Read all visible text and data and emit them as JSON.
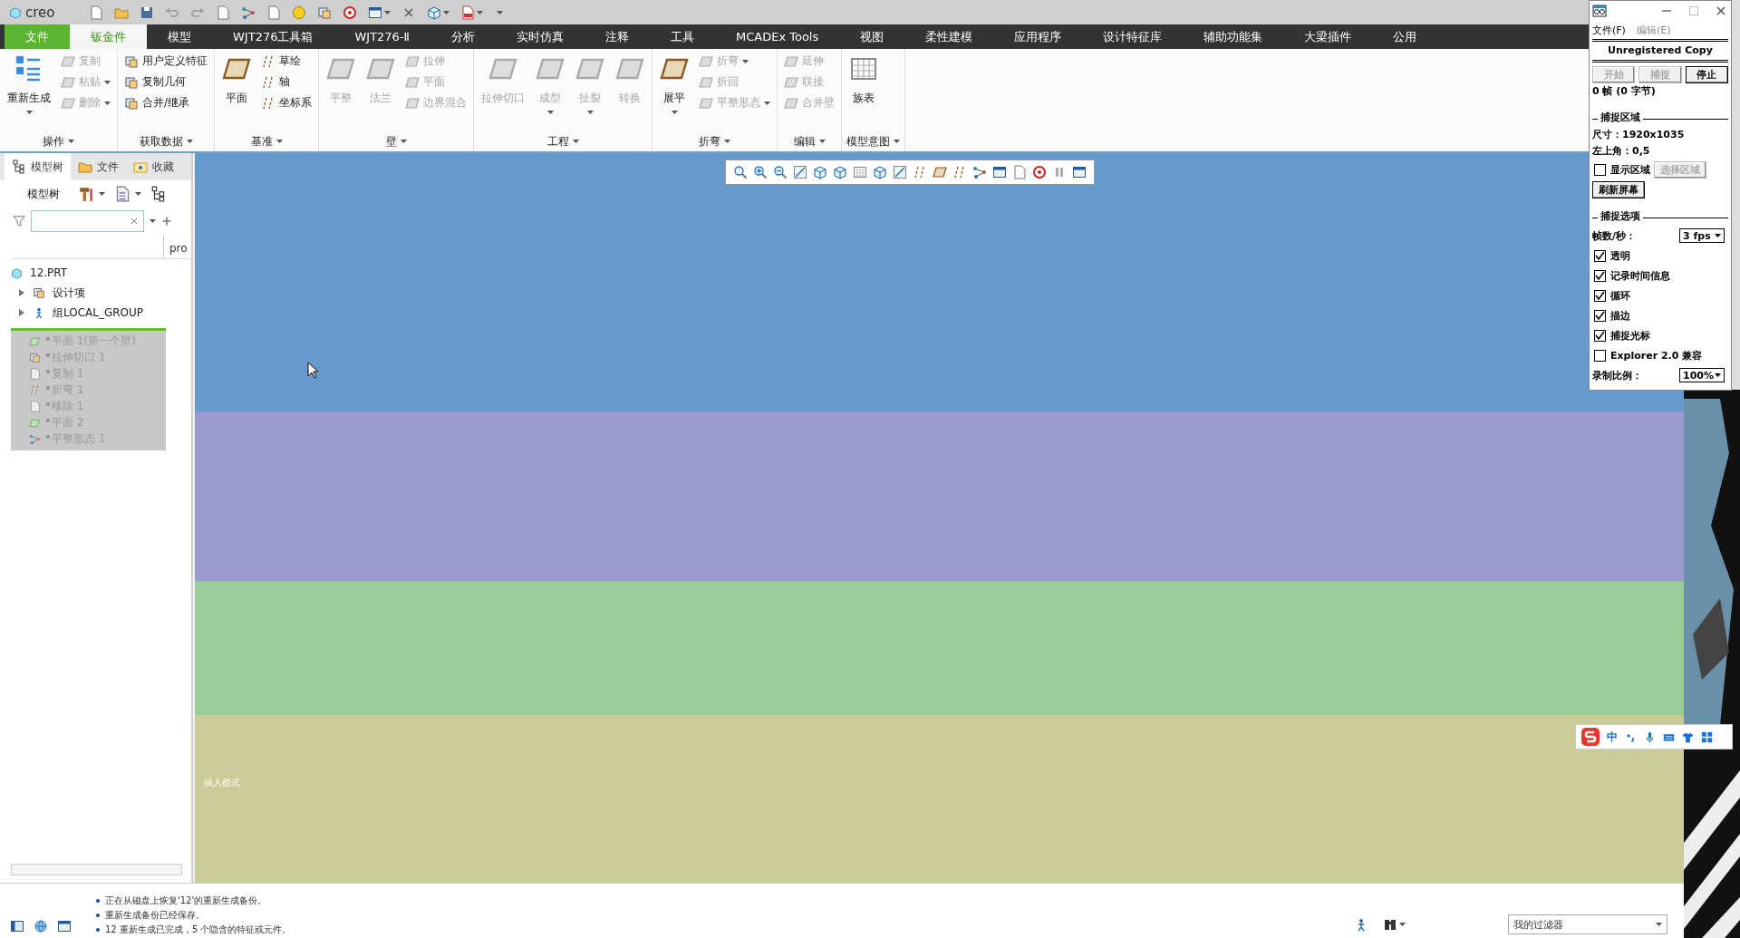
{
  "app": {
    "logo": "creo"
  },
  "tabs": [
    {
      "label": "文件",
      "kind": "file",
      "selected": false
    },
    {
      "label": "钣金件",
      "kind": "tab",
      "selected": true
    },
    {
      "label": "模型",
      "kind": "tab",
      "selected": false
    },
    {
      "label": "WJT276工具箱",
      "kind": "tab",
      "selected": false
    },
    {
      "label": "WJT276-Ⅱ",
      "kind": "tab",
      "selected": false
    },
    {
      "label": "分析",
      "kind": "tab",
      "selected": false
    },
    {
      "label": "实时仿真",
      "kind": "tab",
      "selected": false
    },
    {
      "label": "注释",
      "kind": "tab",
      "selected": false
    },
    {
      "label": "工具",
      "kind": "tab",
      "selected": false
    },
    {
      "label": "MCADEx Tools",
      "kind": "tab",
      "selected": false
    },
    {
      "label": "视图",
      "kind": "tab",
      "selected": false
    },
    {
      "label": "柔性建模",
      "kind": "tab",
      "selected": false
    },
    {
      "label": "应用程序",
      "kind": "tab",
      "selected": false
    },
    {
      "label": "设计特征库",
      "kind": "tab",
      "selected": false
    },
    {
      "label": "辅助功能集",
      "kind": "tab",
      "selected": false
    },
    {
      "label": "大梁插件",
      "kind": "tab",
      "selected": false
    },
    {
      "label": "公用",
      "kind": "tab",
      "selected": false
    }
  ],
  "ribbon": [
    {
      "title": "操作",
      "columns": [
        {
          "kind": "large",
          "label": "重新生成",
          "disabled": false,
          "dropdown": true
        },
        {
          "kind": "stack",
          "items": [
            {
              "label": "复制",
              "disabled": true,
              "dropdown": false
            },
            {
              "label": "粘贴",
              "disabled": true,
              "dropdown": true
            },
            {
              "label": "删除",
              "disabled": true,
              "dropdown": true
            }
          ]
        }
      ]
    },
    {
      "title": "获取数据",
      "columns": [
        {
          "kind": "stack",
          "items": [
            {
              "label": "用户定义特征",
              "disabled": false,
              "dropdown": false
            },
            {
              "label": "复制几何",
              "disabled": false,
              "dropdown": false
            },
            {
              "label": "合并/继承",
              "disabled": false,
              "dropdown": false
            }
          ]
        }
      ]
    },
    {
      "title": "基准",
      "columns": [
        {
          "kind": "large",
          "label": "平面",
          "disabled": false,
          "dropdown": false
        },
        {
          "kind": "stack",
          "items": [
            {
              "label": "草绘",
              "disabled": false,
              "dropdown": false
            },
            {
              "label": "轴",
              "disabled": false,
              "dropdown": false
            },
            {
              "label": "坐标系",
              "disabled": false,
              "dropdown": false
            }
          ]
        }
      ]
    },
    {
      "title": "壁",
      "columns": [
        {
          "kind": "large",
          "label": "平整",
          "disabled": true,
          "dropdown": false
        },
        {
          "kind": "large",
          "label": "法兰",
          "disabled": true,
          "dropdown": false
        },
        {
          "kind": "stack",
          "items": [
            {
              "label": "拉伸",
              "disabled": true,
              "dropdown": false
            },
            {
              "label": "平面",
              "disabled": true,
              "dropdown": false
            },
            {
              "label": "边界混合",
              "disabled": true,
              "dropdown": false
            }
          ]
        }
      ]
    },
    {
      "title": "工程",
      "columns": [
        {
          "kind": "large",
          "label": "拉伸切口",
          "disabled": true,
          "dropdown": false
        },
        {
          "kind": "large",
          "label": "成型",
          "disabled": true,
          "dropdown": true
        },
        {
          "kind": "large",
          "label": "扯裂",
          "disabled": true,
          "dropdown": true
        },
        {
          "kind": "large",
          "label": "转换",
          "disabled": true,
          "dropdown": false
        }
      ]
    },
    {
      "title": "折弯",
      "columns": [
        {
          "kind": "large",
          "label": "展平",
          "disabled": false,
          "dropdown": true
        },
        {
          "kind": "stack",
          "items": [
            {
              "label": "折弯",
              "disabled": true,
              "dropdown": true
            },
            {
              "label": "折回",
              "disabled": true,
              "dropdown": false
            },
            {
              "label": "平整形态",
              "disabled": true,
              "dropdown": true
            }
          ]
        }
      ]
    },
    {
      "title": "编辑",
      "columns": [
        {
          "kind": "stack",
          "items": [
            {
              "label": "延伸",
              "disabled": true,
              "dropdown": false
            },
            {
              "label": "联接",
              "disabled": true,
              "dropdown": false
            },
            {
              "label": "合并壁",
              "disabled": true,
              "dropdown": false
            }
          ]
        }
      ]
    },
    {
      "title": "模型意图",
      "columns": [
        {
          "kind": "large",
          "label": "族表",
          "disabled": false,
          "dropdown": false
        }
      ]
    }
  ],
  "left_panel": {
    "tabs": [
      {
        "label": "模型树",
        "selected": true
      },
      {
        "label": "文件",
        "selected": false
      },
      {
        "label": "收藏",
        "selected": false
      }
    ],
    "toolbar_label": "模型树",
    "column_header": "pro",
    "tree": {
      "root": "12.PRT",
      "folders": [
        {
          "label": "设计项",
          "expanded": false
        },
        {
          "label": "组LOCAL_GROUP",
          "expanded": false
        }
      ],
      "after_insert": [
        "平面 1(第一个壁)",
        "拉伸切口 1",
        "复制 1",
        "折弯 1",
        "移除 1",
        "平面 2",
        "平整形态 1"
      ]
    }
  },
  "viewport": {
    "mode_text": "插入模式"
  },
  "messages": [
    "正在从磁盘上恢复'12'的重新生成备份。",
    "重新生成备份已经保存。",
    "12 重新生成已完成，5 个隐含的特征或元件。"
  ],
  "filter": {
    "value": "我的过滤器"
  },
  "capture_window": {
    "menu": [
      {
        "label": "文件(F)",
        "disabled": false
      },
      {
        "label": "编辑(E)",
        "disabled": true
      }
    ],
    "banner": "Unregistered Copy",
    "buttons": [
      {
        "label": "开始",
        "disabled": true
      },
      {
        "label": "捕捉",
        "disabled": true
      },
      {
        "label": "停止",
        "disabled": false
      }
    ],
    "frame_info": "0 帧 (0 字节)",
    "area": {
      "title": "捕捉区域",
      "size": "尺寸：1920x1035",
      "origin": "左上角：0,5",
      "show_area": {
        "label": "显示区域",
        "checked": false
      },
      "select_button": {
        "label": "选择区域",
        "disabled": true
      },
      "refresh_button": "刷新屏幕"
    },
    "options": {
      "title": "捕捉选项",
      "fps_label": "帧数/秒：",
      "fps_value": "3 fps",
      "checkboxes": [
        {
          "label": "透明",
          "checked": true
        },
        {
          "label": "记录时间信息",
          "checked": true
        },
        {
          "label": "循环",
          "checked": true
        },
        {
          "label": "描边",
          "checked": true
        },
        {
          "label": "捕捉光标",
          "checked": true
        },
        {
          "label": "Explorer 2.0 兼容",
          "checked": false
        }
      ],
      "scale_label": "录制比例：",
      "scale_value": "100%"
    }
  },
  "ime": {
    "mode": "中"
  }
}
